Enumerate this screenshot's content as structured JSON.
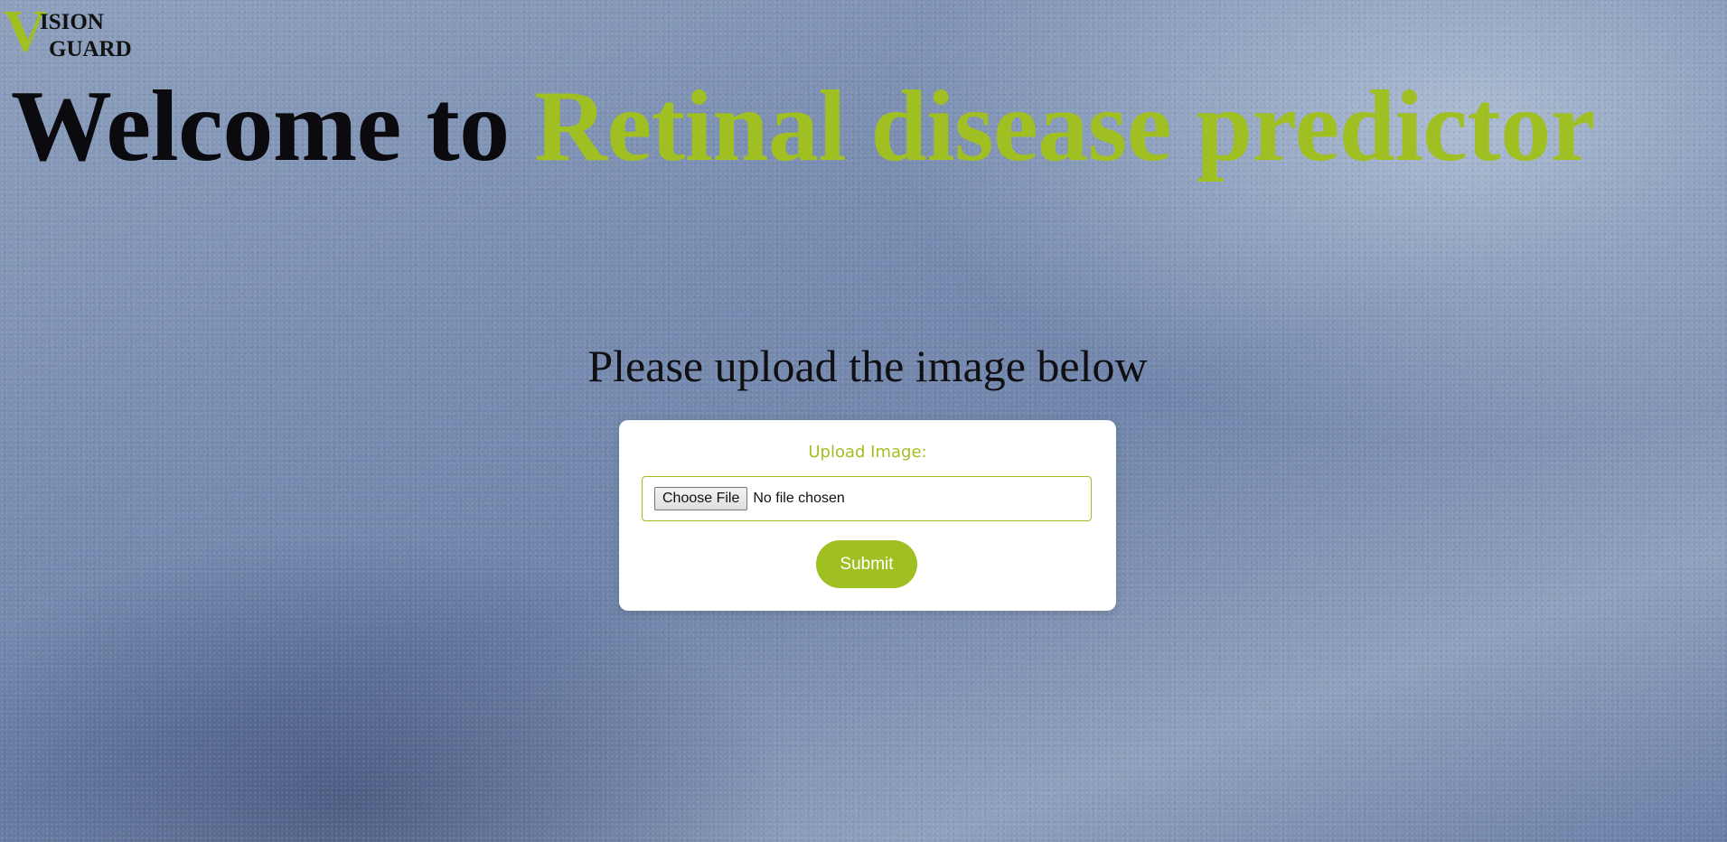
{
  "brand": {
    "logo_letter": "V",
    "logo_line1": "ISION",
    "logo_line2": "GUARD",
    "accent_color": "#a0bf22"
  },
  "headline": {
    "part1": "Welcome to ",
    "part2": "Retinal disease predictor"
  },
  "subtitle": "Please upload the image below",
  "upload_form": {
    "label": "Upload Image:",
    "choose_button": "Choose File",
    "file_status": "No file chosen",
    "submit_label": "Submit"
  }
}
